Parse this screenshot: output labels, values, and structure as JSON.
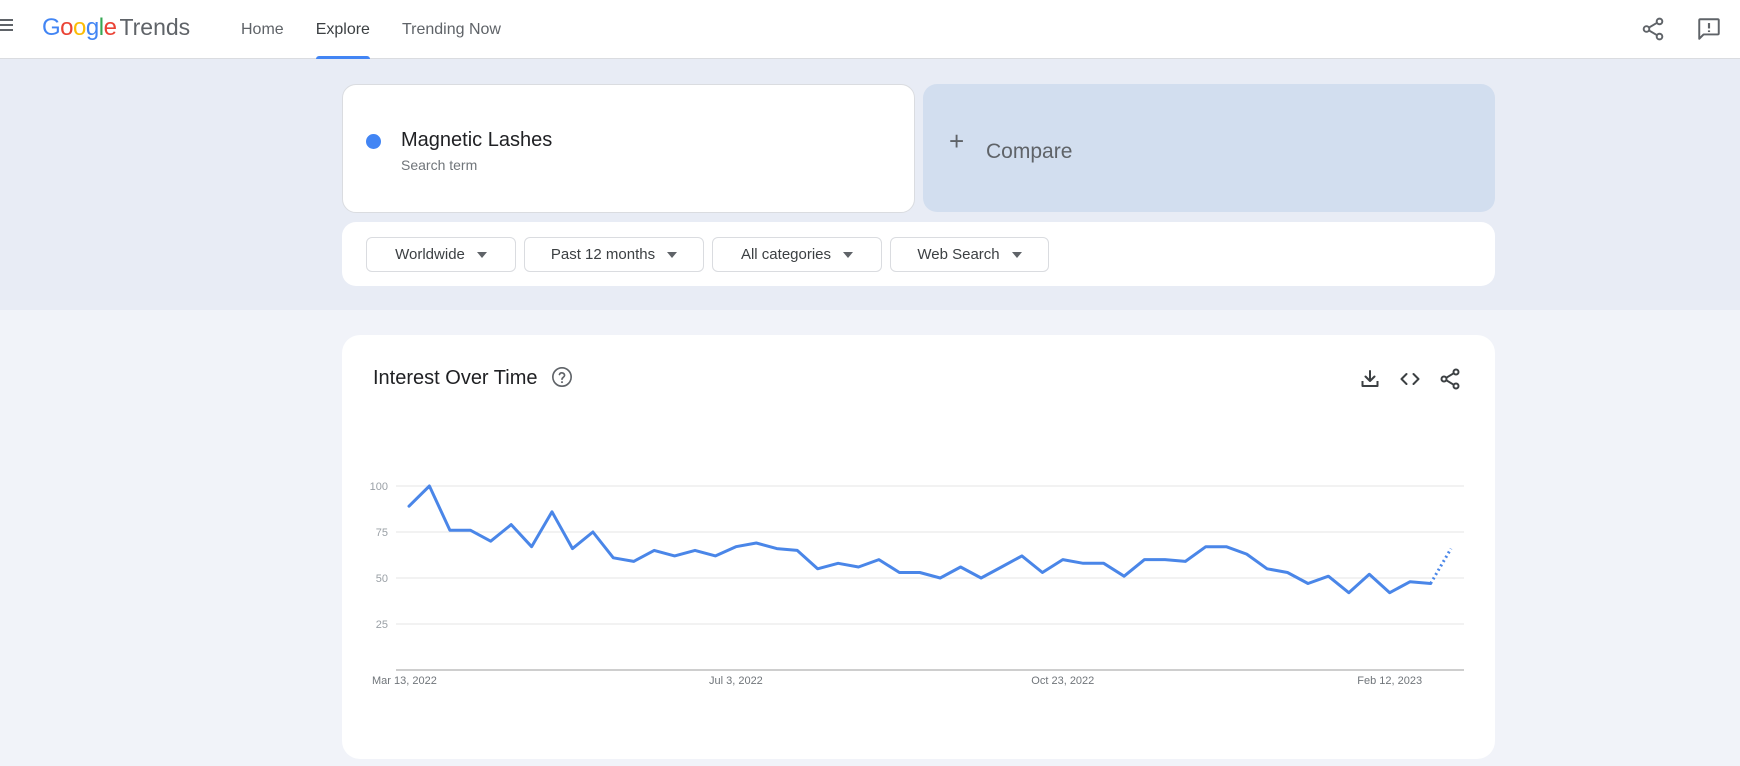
{
  "header": {
    "logo_google": "Google",
    "logo_trends": "Trends",
    "nav": [
      {
        "label": "Home",
        "active": false
      },
      {
        "label": "Explore",
        "active": true
      },
      {
        "label": "Trending Now",
        "active": false
      }
    ],
    "icons": [
      "menu-icon",
      "share-icon",
      "feedback-icon"
    ]
  },
  "search": {
    "term": "Magnetic Lashes",
    "subtitle": "Search term",
    "dot_color": "#4285f4",
    "compare_label": "Compare"
  },
  "filters": [
    {
      "label": "Worldwide"
    },
    {
      "label": "Past 12 months"
    },
    {
      "label": "All categories"
    },
    {
      "label": "Web Search"
    }
  ],
  "panel": {
    "title": "Interest Over Time",
    "icons": [
      "help-icon",
      "download-icon",
      "embed-icon",
      "share-icon"
    ]
  },
  "colors": {
    "accent": "#4285f4",
    "line": "#4a86e8",
    "band": "#e8ecf5",
    "compare_bg": "#d2deef"
  },
  "chart_data": {
    "type": "line",
    "series_color": "#4a86e8",
    "ylim": [
      0,
      100
    ],
    "yticks": [
      25,
      50,
      75,
      100
    ],
    "grid": true,
    "xtick_labels": [
      "Mar 13, 2022",
      "Jul 3, 2022",
      "Oct 23, 2022",
      "Feb 12, 2023"
    ],
    "xtick_indices": [
      0,
      16,
      32,
      48
    ],
    "x": [
      "2022-03-13",
      "2022-03-20",
      "2022-03-27",
      "2022-04-03",
      "2022-04-10",
      "2022-04-17",
      "2022-04-24",
      "2022-05-01",
      "2022-05-08",
      "2022-05-15",
      "2022-05-22",
      "2022-05-29",
      "2022-06-05",
      "2022-06-12",
      "2022-06-19",
      "2022-06-26",
      "2022-07-03",
      "2022-07-10",
      "2022-07-17",
      "2022-07-24",
      "2022-07-31",
      "2022-08-07",
      "2022-08-14",
      "2022-08-21",
      "2022-08-28",
      "2022-09-04",
      "2022-09-11",
      "2022-09-18",
      "2022-09-25",
      "2022-10-02",
      "2022-10-09",
      "2022-10-16",
      "2022-10-23",
      "2022-10-30",
      "2022-11-06",
      "2022-11-13",
      "2022-11-20",
      "2022-11-27",
      "2022-12-04",
      "2022-12-11",
      "2022-12-18",
      "2022-12-25",
      "2023-01-01",
      "2023-01-08",
      "2023-01-15",
      "2023-01-22",
      "2023-01-29",
      "2023-02-05",
      "2023-02-12",
      "2023-02-19",
      "2023-02-26",
      "2023-03-05"
    ],
    "values": [
      89,
      100,
      76,
      76,
      70,
      79,
      67,
      86,
      66,
      75,
      61,
      59,
      65,
      62,
      65,
      62,
      67,
      69,
      66,
      65,
      55,
      58,
      56,
      60,
      53,
      53,
      50,
      56,
      50,
      56,
      62,
      53,
      60,
      58,
      58,
      51,
      60,
      60,
      59,
      67,
      67,
      63,
      55,
      53,
      47,
      51,
      42,
      52,
      42,
      48,
      47,
      66
    ],
    "partial_from_index": 50
  }
}
